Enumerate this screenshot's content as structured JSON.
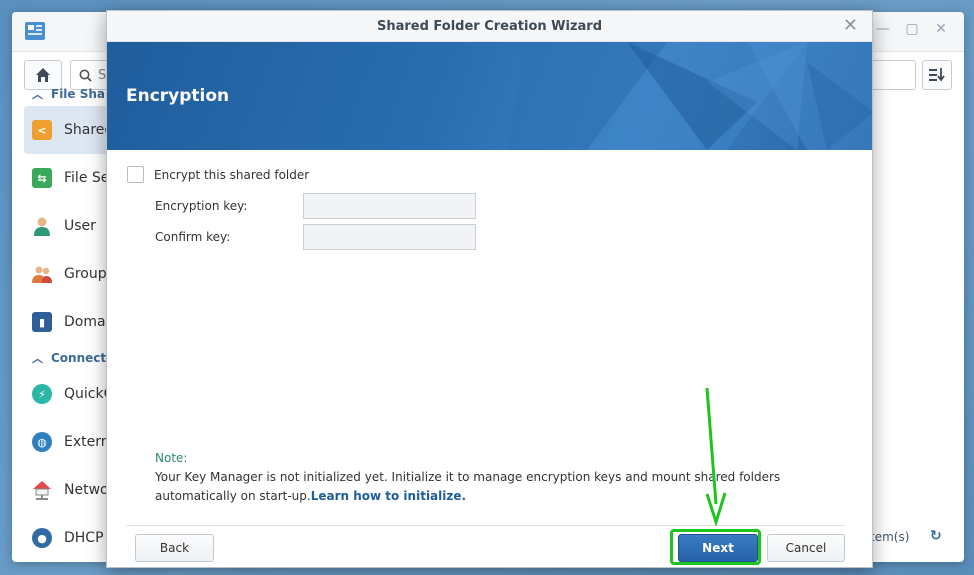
{
  "background_window": {
    "search_placeholder": "S",
    "sections": [
      {
        "label": "File Sha",
        "items": [
          {
            "label": "Shared",
            "icon": "shared-folder-icon",
            "color": "#f0a030",
            "active": true
          },
          {
            "label": "File Se",
            "icon": "file-services-icon",
            "color": "#3aaa5a"
          },
          {
            "label": "User",
            "icon": "user-icon",
            "color": "#2d9a77"
          },
          {
            "label": "Group",
            "icon": "group-icon",
            "color": "#e07a3a"
          },
          {
            "label": "Domain",
            "icon": "domain-icon",
            "color": "#2f5f99"
          }
        ]
      },
      {
        "label": "Connect",
        "items": [
          {
            "label": "QuickC",
            "icon": "quickconnect-icon",
            "color": "#2ab7a8"
          },
          {
            "label": "Extern",
            "icon": "external-access-icon",
            "color": "#2d7fc0"
          },
          {
            "label": "Networ",
            "icon": "network-icon",
            "color": "#e04a4a"
          },
          {
            "label": "DHCP S",
            "icon": "dhcp-server-icon",
            "color": "#2f6ca3"
          }
        ]
      }
    ],
    "footer_text": "tem(s)"
  },
  "wizard": {
    "title": "Shared Folder Creation Wizard",
    "banner_title": "Encryption",
    "encrypt_label": "Encrypt this shared folder",
    "encryption_key_label": "Encryption key:",
    "confirm_key_label": "Confirm key:",
    "note_title": "Note:",
    "note_text": "Your Key Manager is not initialized yet. Initialize it to manage encryption keys and mount shared folders automatically on start-up.",
    "note_link": "Learn how to initialize.",
    "back_label": "Back",
    "next_label": "Next",
    "cancel_label": "Cancel"
  },
  "colors": {
    "banner": "#2a6fb0",
    "primary_button": "#2562a8",
    "annotation": "#1fc41f",
    "note_title": "#2d8a6c"
  }
}
